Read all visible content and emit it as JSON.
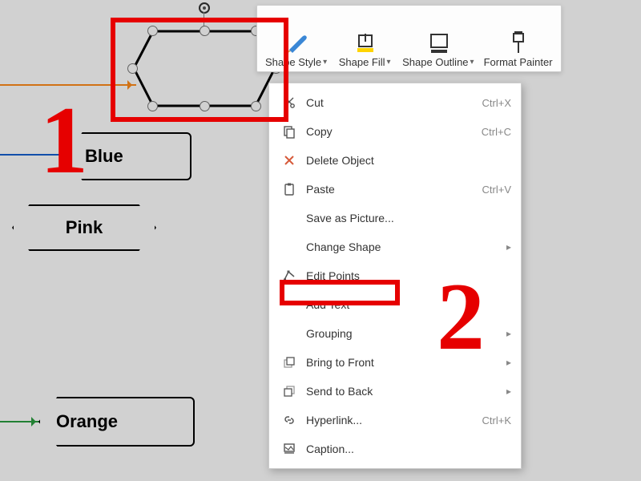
{
  "shapes": {
    "selected": "",
    "blue": "Blue",
    "pink": "Pink",
    "orange": "Orange"
  },
  "toolbar": {
    "shape_style": "Shape Style",
    "shape_fill": "Shape Fill",
    "shape_outline": "Shape Outline",
    "format_painter": "Format Painter"
  },
  "menu": {
    "cut": "Cut",
    "cut_sc": "Ctrl+X",
    "copy": "Copy",
    "copy_sc": "Ctrl+C",
    "delete_object": "Delete Object",
    "paste": "Paste",
    "paste_sc": "Ctrl+V",
    "save_picture": "Save as Picture...",
    "change_shape": "Change Shape",
    "edit_points": "Edit Points",
    "add_text": "Add Text",
    "grouping": "Grouping",
    "bring_front": "Bring to Front",
    "send_back": "Send to Back",
    "hyperlink": "Hyperlink...",
    "hyperlink_sc": "Ctrl+K",
    "caption": "Caption..."
  },
  "annotations": {
    "step1": "1",
    "step2": "2"
  }
}
